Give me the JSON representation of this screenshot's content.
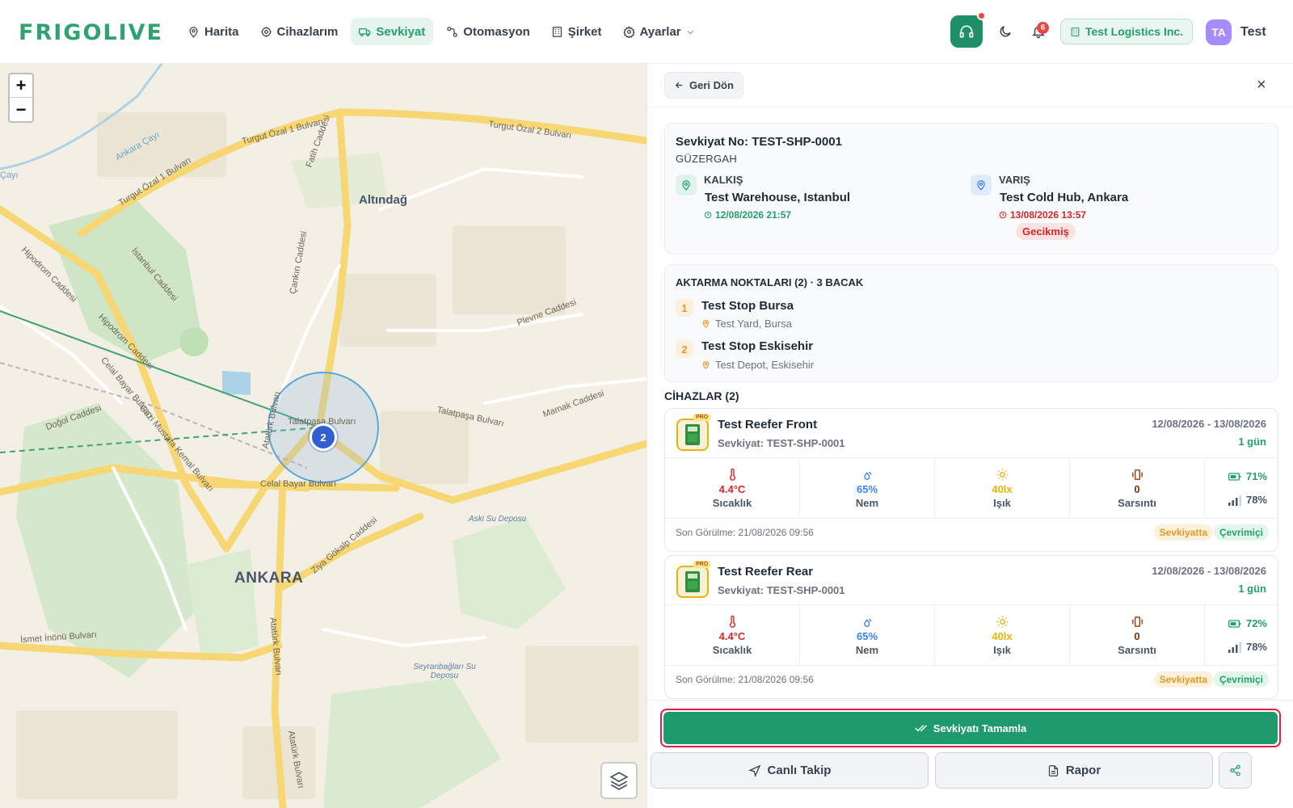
{
  "brand": {
    "logo_text": "FRIGOLIVE",
    "accent": "#22a06b"
  },
  "nav": {
    "items": [
      {
        "label": "Harita",
        "icon": "map-pin-icon"
      },
      {
        "label": "Cihazlarım",
        "icon": "chip-icon"
      },
      {
        "label": "Sevkiyat",
        "icon": "truck-icon",
        "active": true
      },
      {
        "label": "Otomasyon",
        "icon": "workflow-icon"
      },
      {
        "label": "Şirket",
        "icon": "building-icon"
      },
      {
        "label": "Ayarlar",
        "icon": "gear-icon"
      }
    ],
    "notification_count": "6",
    "company": "Test Logistics Inc.",
    "avatar_initials": "TA",
    "user_name": "Test"
  },
  "map": {
    "labels": {
      "turgut1": "Turgut Özal 1 Bulvarı",
      "turgut1b": "Turgut Özal 1 Bulvarı",
      "turgut2": "Turgut Özal 2 Bulvarı",
      "fatih": "Fatih Caddesi",
      "cayi": "Çayı",
      "ankara_cayi": "Ankara Çayı",
      "altindag": "Altındağ",
      "cankiri": "Çankırı Caddesi",
      "istanbul": "İstanbul Caddesi",
      "hipodrom1": "Hipodrom Caddesi",
      "hipodrom2": "Hipodrom Caddesi",
      "plevne": "Plevne Caddesi",
      "celal1": "Celal Bayar Bulvarı",
      "celal2": "Celal Bayar Bulvarı",
      "dogol": "Doğol Caddesi",
      "gazi": "Gazi Mustafa Kemal Bulvarı",
      "ataturk1": "Atatürk Bulvarı",
      "ataturk2": "Atatürk Bulvarı",
      "ataturk3": "Atatürk Bulvarı",
      "talatpasa1": "Talatpaşa Bulvarı",
      "talatpasa2": "Talatpaşa Bulvarı",
      "mamak": "Mamak Caddesi",
      "aski": "Aski Su Deposu",
      "ziya": "Ziya Gökalp Caddesi",
      "ankara": "ANKARA",
      "ismet": "İsmet İnönü Bulvarı",
      "seyran": "Seyranbağları Su Deposu"
    },
    "cluster_count": "2",
    "zoom_in": "+",
    "zoom_out": "−"
  },
  "panel": {
    "back_label": "Geri Dön",
    "close_label": "×",
    "shipment_label": "Sevkiyat No:",
    "shipment_no": "TEST-SHP-0001",
    "route_heading": "GÜZERGAH",
    "origin": {
      "label": "KALKIŞ",
      "name": "Test Warehouse, Istanbul",
      "time": "12/08/2026 21:57"
    },
    "destination": {
      "label": "VARIŞ",
      "name": "Test Cold Hub, Ankara",
      "time": "13/08/2026 13:57",
      "status": "Gecikmiş"
    },
    "transfers": {
      "title": "AKTARMA NOKTALARI (2) · 3 BACAK",
      "items": [
        {
          "num": "1",
          "name": "Test Stop Bursa",
          "address": "Test Yard, Bursa"
        },
        {
          "num": "2",
          "name": "Test Stop Eskisehir",
          "address": "Test Depot, Eskisehir"
        }
      ]
    },
    "devices_title": "CİHAZLAR (2)",
    "devices": [
      {
        "name": "Test Reefer Front",
        "shipment": "Sevkiyat: TEST-SHP-0001",
        "range": "12/08/2026 - 13/08/2026",
        "days": "1 gün",
        "badge": "PRO",
        "temp": "4.4°C",
        "temp_label": "Sıcaklık",
        "humidity": "65%",
        "humidity_label": "Nem",
        "light": "40lx",
        "light_label": "Işık",
        "shock": "0",
        "shock_label": "Sarsıntı",
        "battery": "71%",
        "signal": "78%",
        "last_seen": "Son Görülme: 21/08/2026 09:56",
        "status_ship": "Sevkiyatta",
        "status_online": "Çevrimiçi"
      },
      {
        "name": "Test Reefer Rear",
        "shipment": "Sevkiyat: TEST-SHP-0001",
        "range": "12/08/2026 - 13/08/2026",
        "days": "1 gün",
        "badge": "PRO",
        "temp": "4.4°C",
        "temp_label": "Sıcaklık",
        "humidity": "65%",
        "humidity_label": "Nem",
        "light": "40lx",
        "light_label": "Işık",
        "shock": "0",
        "shock_label": "Sarsıntı",
        "battery": "72%",
        "signal": "78%",
        "last_seen": "Son Görülme: 21/08/2026 09:56",
        "status_ship": "Sevkiyatta",
        "status_online": "Çevrimiçi"
      }
    ],
    "complete_label": "Sevkiyatı Tamamla",
    "live_label": "Canlı Takip",
    "report_label": "Rapor"
  },
  "colors": {
    "danger": "#dc2626",
    "humidity": "#3b82f6",
    "light": "#eab308",
    "shock": "#92400e",
    "late_bg": "#fde2e2"
  }
}
